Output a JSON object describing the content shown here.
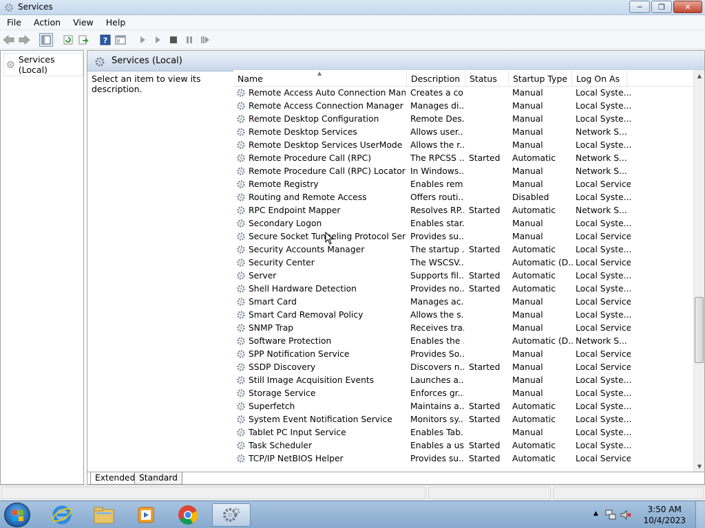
{
  "window": {
    "title": "Services"
  },
  "menu": [
    "File",
    "Action",
    "View",
    "Help"
  ],
  "tree": {
    "root_label": "Services (Local)"
  },
  "main": {
    "header_title": "Services (Local)",
    "description_hint": "Select an item to view its description."
  },
  "columns": [
    "Name",
    "Description",
    "Status",
    "Startup Type",
    "Log On As"
  ],
  "rows": [
    [
      "Remote Access Auto Connection Manager",
      "Creates a co...",
      "",
      "Manual",
      "Local Syste..."
    ],
    [
      "Remote Access Connection Manager",
      "Manages di...",
      "",
      "Manual",
      "Local Syste..."
    ],
    [
      "Remote Desktop Configuration",
      "Remote Des...",
      "",
      "Manual",
      "Local Syste..."
    ],
    [
      "Remote Desktop Services",
      "Allows user...",
      "",
      "Manual",
      "Network S..."
    ],
    [
      "Remote Desktop Services UserMode Port ...",
      "Allows the r...",
      "",
      "Manual",
      "Local Syste..."
    ],
    [
      "Remote Procedure Call (RPC)",
      "The RPCSS ...",
      "Started",
      "Automatic",
      "Network S..."
    ],
    [
      "Remote Procedure Call (RPC) Locator",
      "In Windows...",
      "",
      "Manual",
      "Network S..."
    ],
    [
      "Remote Registry",
      "Enables rem...",
      "",
      "Manual",
      "Local Service"
    ],
    [
      "Routing and Remote Access",
      "Offers routi...",
      "",
      "Disabled",
      "Local Syste..."
    ],
    [
      "RPC Endpoint Mapper",
      "Resolves RP...",
      "Started",
      "Automatic",
      "Network S..."
    ],
    [
      "Secondary Logon",
      "Enables star...",
      "",
      "Manual",
      "Local Syste..."
    ],
    [
      "Secure Socket Tunneling Protocol Service",
      "Provides su...",
      "",
      "Manual",
      "Local Service"
    ],
    [
      "Security Accounts Manager",
      "The startup ...",
      "Started",
      "Automatic",
      "Local Syste..."
    ],
    [
      "Security Center",
      "The WSCSV...",
      "",
      "Automatic (D...",
      "Local Service"
    ],
    [
      "Server",
      "Supports fil...",
      "Started",
      "Automatic",
      "Local Syste..."
    ],
    [
      "Shell Hardware Detection",
      "Provides no...",
      "Started",
      "Automatic",
      "Local Syste..."
    ],
    [
      "Smart Card",
      "Manages ac...",
      "",
      "Manual",
      "Local Service"
    ],
    [
      "Smart Card Removal Policy",
      "Allows the s...",
      "",
      "Manual",
      "Local Syste..."
    ],
    [
      "SNMP Trap",
      "Receives tra...",
      "",
      "Manual",
      "Local Service"
    ],
    [
      "Software Protection",
      "Enables the ...",
      "",
      "Automatic (D...",
      "Network S..."
    ],
    [
      "SPP Notification Service",
      "Provides So...",
      "",
      "Manual",
      "Local Service"
    ],
    [
      "SSDP Discovery",
      "Discovers n...",
      "Started",
      "Manual",
      "Local Service"
    ],
    [
      "Still Image Acquisition Events",
      "Launches a...",
      "",
      "Manual",
      "Local Syste..."
    ],
    [
      "Storage Service",
      "Enforces gr...",
      "",
      "Manual",
      "Local Syste..."
    ],
    [
      "Superfetch",
      "Maintains a...",
      "Started",
      "Automatic",
      "Local Syste..."
    ],
    [
      "System Event Notification Service",
      "Monitors sy...",
      "Started",
      "Automatic",
      "Local Syste..."
    ],
    [
      "Tablet PC Input Service",
      "Enables Tab...",
      "",
      "Manual",
      "Local Syste..."
    ],
    [
      "Task Scheduler",
      "Enables a us...",
      "Started",
      "Automatic",
      "Local Syste..."
    ],
    [
      "TCP/IP NetBIOS Helper",
      "Provides su...",
      "Started",
      "Automatic",
      "Local Service"
    ]
  ],
  "tabs": {
    "extended": "Extended",
    "standard": "Standard"
  },
  "clock": {
    "time": "3:50 AM",
    "date": "10/4/2023"
  },
  "icons": {
    "app": "gear-icon",
    "toolbar": [
      "back-icon",
      "forward-icon",
      "console-tree-icon",
      "refresh-icon",
      "export-icon",
      "help-icon",
      "properties-icon",
      "start-service-icon",
      "start-alt-icon",
      "stop-icon",
      "pause-icon",
      "resume-icon"
    ],
    "taskbar": [
      "start-orb-icon",
      "internet-explorer-icon",
      "file-explorer-icon",
      "media-player-icon",
      "chrome-icon",
      "services-icon"
    ]
  },
  "colors": {
    "taskbar": "#86a9cf",
    "header": "#c8d7e8",
    "close": "#c2472f"
  }
}
